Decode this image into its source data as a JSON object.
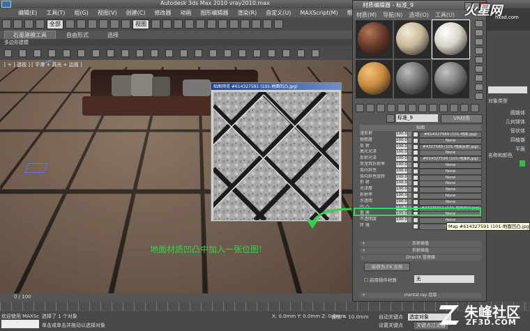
{
  "app": {
    "title": "Autodesk 3ds Max 2010    vray2010.max",
    "menus": [
      "编辑(E)",
      "工具(T)",
      "组(G)",
      "视图(V)",
      "创建(C)",
      "修改器",
      "动画",
      "图形编辑器",
      "渲染(R)",
      "自定义(U)",
      "MAXScript(M)",
      "帮助(H)"
    ],
    "selection_filter": "全部",
    "refcoord": "视图",
    "ribbon_tabs": [
      "石墨建模工具",
      "自由形式",
      "选择"
    ],
    "ribbon_sub": "多边形建模",
    "viewport_label": "[ + ] 透视 ] [ 平滑 + 高光 + 边面 ]",
    "annotation": "地面材质凹凸中加入一张位图!"
  },
  "map_view": {
    "title": "贴图预览 #614327591 (101-地面凹凸.jpg)"
  },
  "material_editor": {
    "title": "材质编辑器 - 标准_9",
    "menus": [
      "材质(M)",
      "导航(N)",
      "选项(O)",
      "工具(U)"
    ],
    "slots": [
      {
        "color": "#6a3a2a",
        "hi": "#b07a5a",
        "sel": false
      },
      {
        "color": "#c9b89a",
        "hi": "#f4ead8",
        "sel": false
      },
      {
        "color": "#d8d3c8",
        "hi": "#ffffff",
        "sel": true
      },
      {
        "color": "#c88a3e",
        "hi": "#f3c27a",
        "sel": false
      },
      {
        "color": "#6f6f6f",
        "hi": "#bdbdbd",
        "sel": false
      },
      {
        "color": "#7a7a7a",
        "hi": "#c2c2c2",
        "sel": false
      }
    ],
    "material_name": "标准_9",
    "material_type": "VR材质",
    "rollout_title": "贴图",
    "maps": [
      {
        "label": "漫反射",
        "amount": "100.0",
        "map": "#614327589 (101-地面.jpg)"
      },
      {
        "label": "粗糙度",
        "amount": "100.0",
        "map": "None"
      },
      {
        "label": "反 射",
        "amount": "100.0",
        "map": "#4327589 (101-地面反射.jpg)"
      },
      {
        "label": "高光光泽",
        "amount": "100.0",
        "map": "None"
      },
      {
        "label": "反射光泽",
        "amount": "100.0",
        "map": "#614327590 (101-地面R.jpg)"
      },
      {
        "label": "菲涅耳折射率",
        "amount": "100.0",
        "map": "None"
      },
      {
        "label": "各向异性",
        "amount": "100.0",
        "map": "None"
      },
      {
        "label": "各向异性旋转",
        "amount": "100.0",
        "map": "None"
      },
      {
        "label": "折 射",
        "amount": "100.0",
        "map": "None"
      },
      {
        "label": "光泽度",
        "amount": "100.0",
        "map": "None"
      },
      {
        "label": "折射率",
        "amount": "100.0",
        "map": "None"
      },
      {
        "label": "半透明",
        "amount": "100.0",
        "map": "None"
      },
      {
        "label": "凹 凸",
        "amount": "100.0",
        "map": "#43275911 (101-地面凹凸.jpg)"
      },
      {
        "label": "置 换",
        "amount": "100.0",
        "map": "None"
      },
      {
        "label": "不透明度",
        "amount": "100.0",
        "map": "None"
      },
      {
        "label": "环 境",
        "amount": "",
        "map": "None"
      }
    ],
    "rollouts": [
      "反射插值",
      "折射插值",
      "DirectX 管理器"
    ],
    "dx_button": "另存为.FX 文件",
    "dx_checkbox": "启用插件材质",
    "dx_select": "无",
    "mentalray": "mental ray 连接",
    "tooltip": "Map #614327591 (101-地面凹凸.jpg)"
  },
  "command_panel": {
    "header": "对象类型",
    "buttons": [
      "圆锥体",
      "几何球体",
      "管状体",
      "四棱锥",
      "平面"
    ],
    "name_color": "名称和颜色",
    "swatch_color": "#3ab54a"
  },
  "timeline": {
    "frame": "0 / 100"
  },
  "status": {
    "maxscript": "欢迎使用 MAXSc",
    "line1": "选择了 1 个对象",
    "line2": "单击或单击并拖动以选择对象",
    "coords": "X: 0.0mm   Y: 0.0mm   Z: 0.0mm",
    "grid": "栅格 = 10.0mm",
    "autokey": "自动关键点",
    "key_filter": "选定对象",
    "set_key": "设置关键点",
    "key_filters_btn": "关键点过滤器"
  },
  "watermark": {
    "top_brand": "火星网",
    "top_url": "hxsd.com",
    "bottom_brand": "朱峰社区",
    "bottom_url": "ZF3D.COM"
  }
}
